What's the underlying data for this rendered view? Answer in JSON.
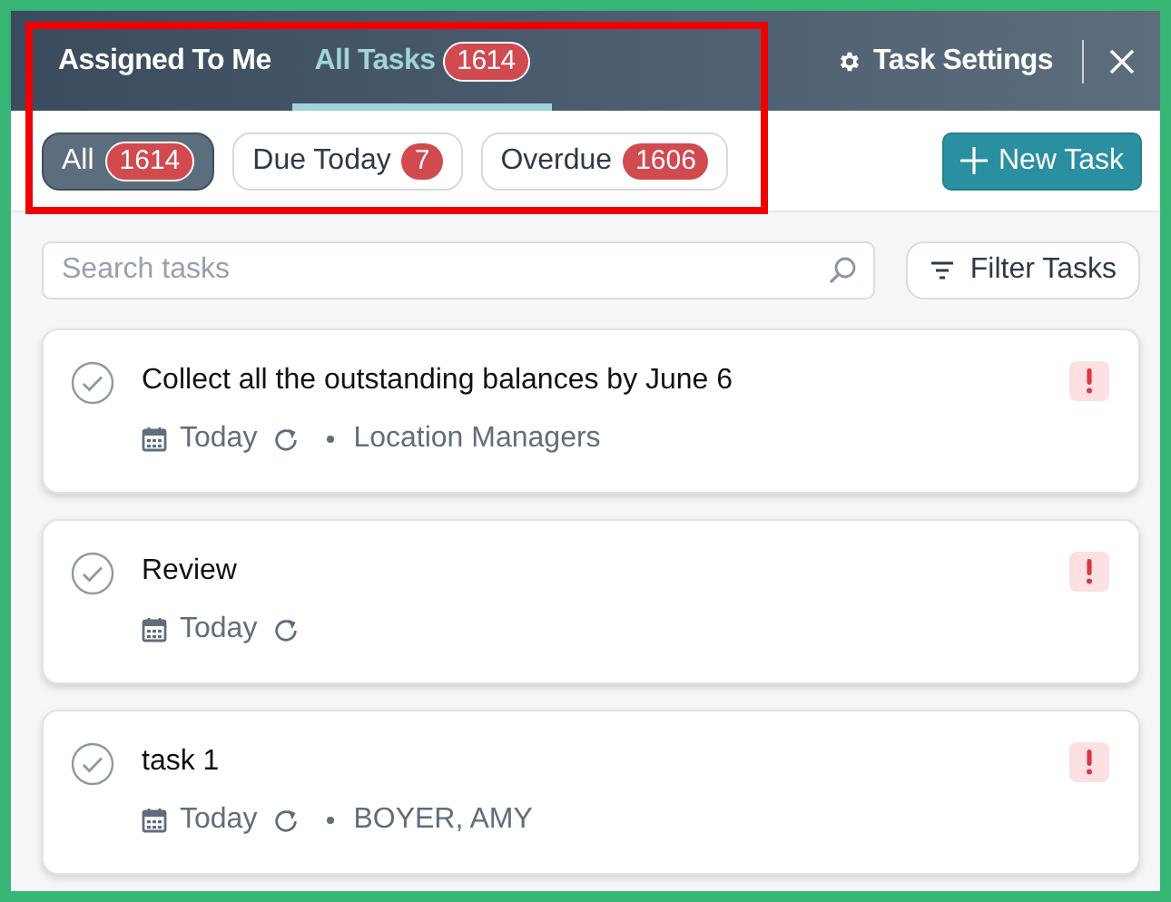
{
  "header": {
    "tabs": [
      {
        "label": "Assigned To Me",
        "selected": false
      },
      {
        "label": "All Tasks",
        "count": "1614",
        "selected": true
      }
    ],
    "settings": "Task Settings"
  },
  "filters": [
    {
      "label": "All",
      "count": "1614",
      "selected": true
    },
    {
      "label": "Due Today",
      "count": "7",
      "selected": false
    },
    {
      "label": "Overdue",
      "count": "1606",
      "selected": false
    }
  ],
  "new_task": "New Task",
  "search": {
    "placeholder": "Search tasks"
  },
  "filter_button": "Filter Tasks",
  "tasks": [
    {
      "title": "Collect all the outstanding balances by June 6",
      "due": "Today",
      "recurring": true,
      "assignee": "Location Managers",
      "high_priority": true
    },
    {
      "title": "Review",
      "due": "Today",
      "recurring": true,
      "high_priority": true
    },
    {
      "title": "task 1",
      "due": "Today",
      "recurring": true,
      "assignee": "BOYER, AMY",
      "high_priority": true
    }
  ]
}
